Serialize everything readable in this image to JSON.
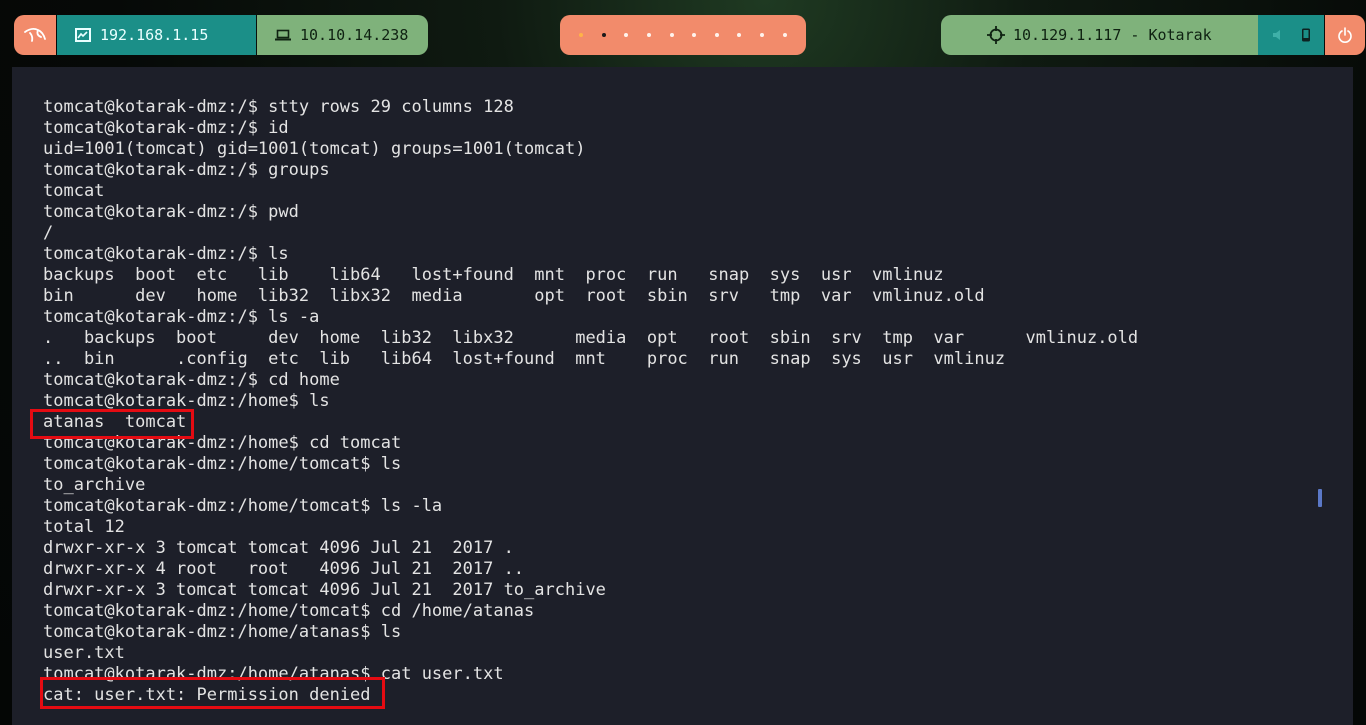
{
  "topbar": {
    "local_ip": "192.168.1.15",
    "vpn_ip": "10.10.14.238",
    "workspaces": [
      "",
      "",
      "",
      "",
      "",
      "",
      "",
      "",
      "",
      ""
    ],
    "target": "10.129.1.117 - Kotarak"
  },
  "terminal": {
    "lines": [
      "tomcat@kotarak-dmz:/$ stty rows 29 columns 128",
      "tomcat@kotarak-dmz:/$ id",
      "uid=1001(tomcat) gid=1001(tomcat) groups=1001(tomcat)",
      "tomcat@kotarak-dmz:/$ groups",
      "tomcat",
      "tomcat@kotarak-dmz:/$ pwd",
      "/",
      "tomcat@kotarak-dmz:/$ ls",
      "backups  boot  etc   lib    lib64   lost+found  mnt  proc  run   snap  sys  usr  vmlinuz",
      "bin      dev   home  lib32  libx32  media       opt  root  sbin  srv   tmp  var  vmlinuz.old",
      "tomcat@kotarak-dmz:/$ ls -a",
      ".   backups  boot     dev  home  lib32  libx32      media  opt   root  sbin  srv  tmp  var      vmlinuz.old",
      "..  bin      .config  etc  lib   lib64  lost+found  mnt    proc  run   snap  sys  usr  vmlinuz",
      "tomcat@kotarak-dmz:/$ cd home",
      "tomcat@kotarak-dmz:/home$ ls",
      "atanas  tomcat",
      "tomcat@kotarak-dmz:/home$ cd tomcat",
      "tomcat@kotarak-dmz:/home/tomcat$ ls",
      "to_archive",
      "tomcat@kotarak-dmz:/home/tomcat$ ls -la",
      "total 12",
      "drwxr-xr-x 3 tomcat tomcat 4096 Jul 21  2017 .",
      "drwxr-xr-x 4 root   root   4096 Jul 21  2017 ..",
      "drwxr-xr-x 3 tomcat tomcat 4096 Jul 21  2017 to_archive",
      "tomcat@kotarak-dmz:/home/tomcat$ cd /home/atanas",
      "tomcat@kotarak-dmz:/home/atanas$ ls",
      "user.txt",
      "tomcat@kotarak-dmz:/home/atanas$ cat user.txt",
      "cat: user.txt: Permission denied"
    ]
  },
  "colors": {
    "accent_salmon": "#f28b6b",
    "accent_teal": "#1b8f88",
    "accent_green": "#7fb27b",
    "terminal_bg": "#1d1f29",
    "highlight_red": "#e50b12"
  }
}
